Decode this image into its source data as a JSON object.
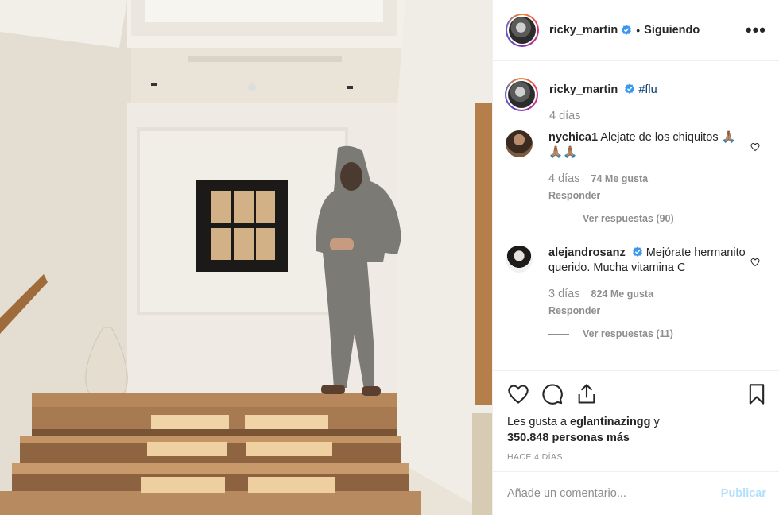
{
  "post": {
    "author": "ricky_martin",
    "follow_status": "Siguiendo",
    "separator": "•",
    "more_icon": "more-horizontal-icon"
  },
  "caption": {
    "username": "ricky_martin",
    "text": "#flu",
    "time": "4 días"
  },
  "comments": [
    {
      "username": "nychica1",
      "text": "Alejate de los chiquitos 🙏🏽🙏🏽🙏🏽",
      "time": "4 días",
      "likes": "74 Me gusta",
      "reply_label": "Responder",
      "view_replies": "Ver respuestas (90)"
    },
    {
      "username": "alejandrosanz",
      "text": "Mejórate hermanito querido. Mucha vitamina C",
      "time": "3 días",
      "likes": "824 Me gusta",
      "reply_label": "Responder",
      "view_replies": "Ver respuestas (11)"
    }
  ],
  "likes_line": {
    "prefix": "Les gusta a",
    "user": "eglantinazingg",
    "connector": "y",
    "count": "350.848 personas más"
  },
  "timestamp": "HACE 4 DÍAS",
  "comment_input": {
    "placeholder": "Añade un comentario...",
    "publish_label": "Publicar"
  },
  "colors": {
    "verified": "#3897f0",
    "hashtag": "#00376b",
    "muted": "#8e8e8e",
    "publish_disabled": "#b2dffc"
  }
}
